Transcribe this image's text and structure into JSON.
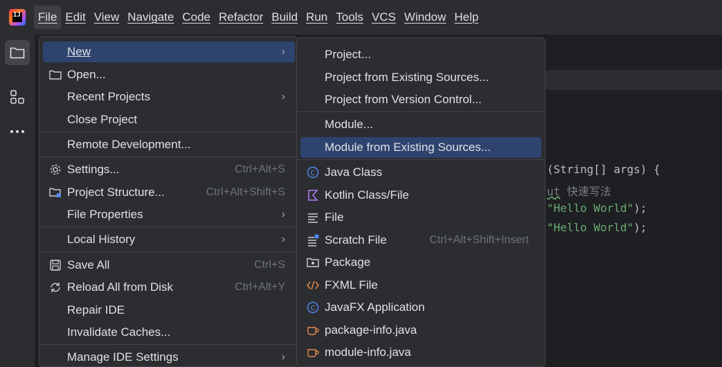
{
  "menubar": {
    "items": [
      "File",
      "Edit",
      "View",
      "Navigate",
      "Code",
      "Refactor",
      "Build",
      "Run",
      "Tools",
      "VCS",
      "Window",
      "Help"
    ]
  },
  "file_menu": {
    "new": "New",
    "open": "Open...",
    "recent_projects": "Recent Projects",
    "close_project": "Close Project",
    "remote_development": "Remote Development...",
    "settings": "Settings...",
    "settings_shortcut": "Ctrl+Alt+S",
    "project_structure": "Project Structure...",
    "project_structure_shortcut": "Ctrl+Alt+Shift+S",
    "file_properties": "File Properties",
    "local_history": "Local History",
    "save_all": "Save All",
    "save_all_shortcut": "Ctrl+S",
    "reload_all": "Reload All from Disk",
    "reload_all_shortcut": "Ctrl+Alt+Y",
    "repair_ide": "Repair IDE",
    "invalidate_caches": "Invalidate Caches...",
    "manage_ide_settings": "Manage IDE Settings"
  },
  "new_menu": {
    "project": "Project...",
    "project_existing": "Project from Existing Sources...",
    "project_vcs": "Project from Version Control...",
    "module": "Module...",
    "module_existing": "Module from Existing Sources...",
    "java_class": "Java Class",
    "kotlin_class": "Kotlin Class/File",
    "file": "File",
    "scratch_file": "Scratch File",
    "scratch_file_shortcut": "Ctrl+Alt+Shift+Insert",
    "package": "Package",
    "fxml_file": "FXML File",
    "javafx_application": "JavaFX Application",
    "package_info": "package-info.java",
    "module_info": "module-info.java"
  },
  "editor": {
    "line1": "(String[] args) {",
    "line2_a": "ut",
    "line2_b": " 快速写法",
    "line3_str": "\"Hello World\"",
    "line3_end": ");",
    "line4_str": "\"Hello World\"",
    "line4_end": ");"
  },
  "colors": {
    "menubar_bg": "#2b2d30",
    "editor_bg": "#1e1f22",
    "selection": "#2e436e",
    "string_green": "#6aab73",
    "java_icon_blue": "#548af7",
    "kotlin_icon_purple": "#b27cf4",
    "fxml_icon_orange": "#e88a4c"
  }
}
